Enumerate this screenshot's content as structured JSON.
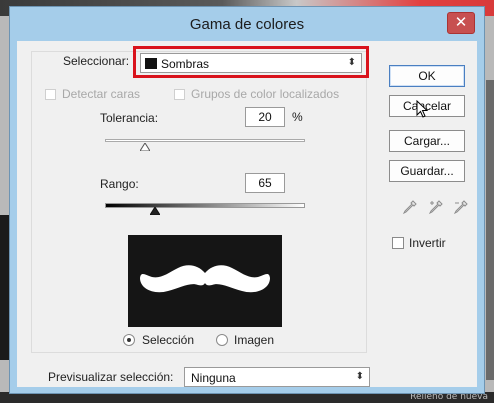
{
  "window": {
    "title": "Gama de colores",
    "close_symbol": "✕"
  },
  "select": {
    "label": "Seleccionar:",
    "value": "Sombras",
    "swatch_color": "#111111"
  },
  "detect_faces": {
    "label": "Detectar caras",
    "checked": false,
    "enabled": false
  },
  "localized_groups": {
    "label": "Grupos de color localizados",
    "checked": false,
    "enabled": false
  },
  "tolerance": {
    "label": "Tolerancia:",
    "value": "20",
    "unit": "%",
    "slider_fraction": 0.2
  },
  "range": {
    "label": "Rango:",
    "value": "65",
    "slider_fraction": 0.25
  },
  "view_mode": {
    "selection_label": "Selección",
    "image_label": "Imagen",
    "selected": "selection"
  },
  "preview_select": {
    "label": "Previsualizar selección:",
    "value": "Ninguna"
  },
  "buttons": {
    "ok": "OK",
    "cancel": "Cancelar",
    "load": "Cargar...",
    "save": "Guardar..."
  },
  "invert": {
    "label": "Invertir",
    "checked": false
  },
  "background": {
    "bottom_text": "Relleno de nueva"
  },
  "colors": {
    "titlebar": "#a5cdea",
    "highlight": "#d9131c",
    "close": "#c75050"
  }
}
